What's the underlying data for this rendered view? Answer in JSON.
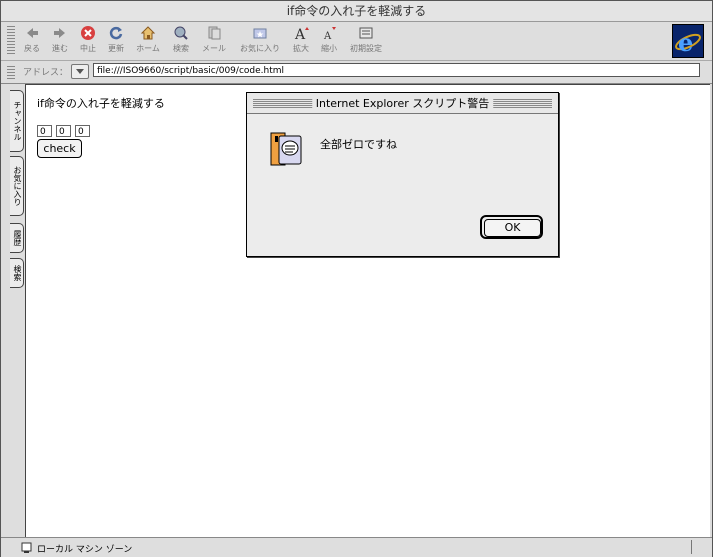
{
  "window": {
    "title": "if命令の入れ子を軽減する"
  },
  "toolbar": {
    "buttons": [
      {
        "label": "戻る",
        "icon": "back-arrow-icon"
      },
      {
        "label": "進む",
        "icon": "forward-arrow-icon"
      },
      {
        "label": "中止",
        "icon": "stop-icon"
      },
      {
        "label": "更新",
        "icon": "refresh-icon"
      },
      {
        "label": "ホーム",
        "icon": "home-icon"
      },
      {
        "label": "検索",
        "icon": "search-icon"
      },
      {
        "label": "メール",
        "icon": "mail-icon"
      },
      {
        "label": "お気に入り",
        "icon": "favorites-icon"
      },
      {
        "label": "拡大",
        "icon": "text-larger-icon"
      },
      {
        "label": "縮小",
        "icon": "text-smaller-icon"
      },
      {
        "label": "初期設定",
        "icon": "preferences-icon"
      }
    ]
  },
  "address": {
    "label": "アドレス：",
    "url": "file:///ISO9660/script/basic/009/code.html"
  },
  "sidebar": {
    "tabs": [
      "チャンネル",
      "お気に入り",
      "履歴",
      "検索"
    ]
  },
  "page": {
    "heading": "if命令の入れ子を軽減する",
    "inputs": [
      "0",
      "0",
      "0"
    ],
    "check_label": "check"
  },
  "dialog": {
    "title": "Internet Explorer スクリプト警告",
    "message": "全部ゼロですね",
    "ok_label": "OK"
  },
  "status": {
    "text": "ローカル マシン ゾーン"
  }
}
